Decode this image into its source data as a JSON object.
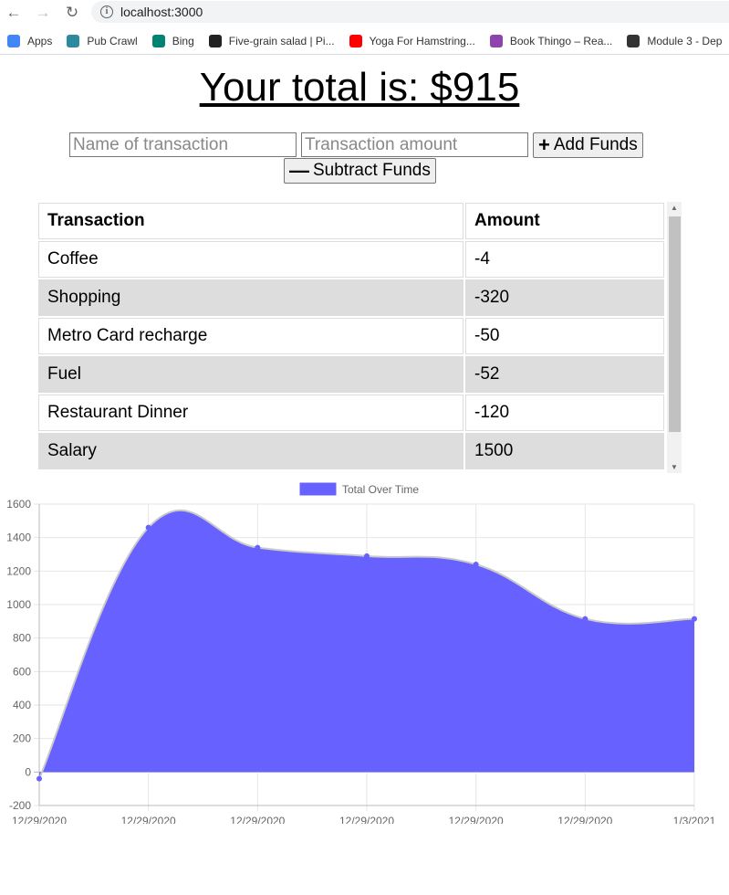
{
  "browser": {
    "url": "localhost:3000",
    "bookmarks": [
      {
        "label": "Apps",
        "icon": "apps-grid-icon",
        "color": "#4285f4"
      },
      {
        "label": "Pub Crawl",
        "icon": "pub-crawl-icon",
        "color": "#2b8a9e"
      },
      {
        "label": "Bing",
        "icon": "bing-icon",
        "color": "#008373"
      },
      {
        "label": "Five-grain salad | Pi...",
        "icon": "salad-icon",
        "color": "#222222"
      },
      {
        "label": "Yoga For Hamstring...",
        "icon": "youtube-icon",
        "color": "#ff0000"
      },
      {
        "label": "Book Thingo – Rea...",
        "icon": "book-thingo-icon",
        "color": "#8e44ad"
      },
      {
        "label": "Module 3 - Dep",
        "icon": "module-book-icon",
        "color": "#333333"
      }
    ]
  },
  "header": {
    "total_text": "Your total is: $915"
  },
  "form": {
    "name_placeholder": "Name of transaction",
    "amount_placeholder": "Transaction amount",
    "add_label": "Add Funds",
    "subtract_label": "Subtract Funds"
  },
  "table": {
    "headers": [
      "Transaction",
      "Amount"
    ],
    "rows": [
      {
        "name": "Coffee",
        "amount": "-4"
      },
      {
        "name": "Shopping",
        "amount": "-320"
      },
      {
        "name": "Metro Card recharge",
        "amount": "-50"
      },
      {
        "name": "Fuel",
        "amount": "-52"
      },
      {
        "name": "Restaurant Dinner",
        "amount": "-120"
      },
      {
        "name": "Salary",
        "amount": "1500"
      }
    ]
  },
  "chart_data": {
    "type": "area",
    "legend": "Total Over Time",
    "x": [
      "12/29/2020",
      "12/29/2020",
      "12/29/2020",
      "12/29/2020",
      "12/29/2020",
      "12/29/2020",
      "1/3/2021"
    ],
    "series": [
      {
        "name": "Total Over Time",
        "values": [
          -40,
          1460,
          1340,
          1290,
          1240,
          915,
          915
        ]
      }
    ],
    "ylim": [
      -200,
      1600
    ],
    "yticks": [
      -200,
      0,
      200,
      400,
      600,
      800,
      1000,
      1200,
      1400,
      1600
    ],
    "fill_color": "#6661ff",
    "grid": true,
    "legend_position": "top"
  }
}
